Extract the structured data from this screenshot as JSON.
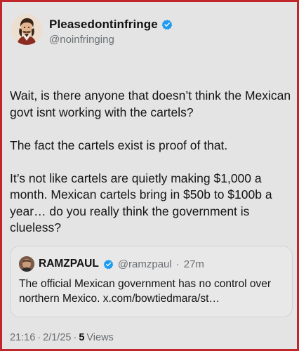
{
  "author": {
    "display_name": "Pleasedontinfringe",
    "handle": "@noinfringing",
    "verified_icon": "verified-badge-icon",
    "verified_color": "#1d9bf0"
  },
  "tweet": {
    "paragraphs": [
      "Wait, is there anyone that doesn’t think the Mexican govt isnt working with the cartels?",
      "The fact the cartels exist is proof of that.",
      "It’s not like cartels are quietly making $1,000 a month. Mexican cartels bring in $50b to $100b a year… do you really think the government is clueless?"
    ]
  },
  "quote": {
    "display_name": "RAMZPAUL",
    "handle": "@ramzpaul",
    "separator": "·",
    "time": "27m",
    "text": "The official Mexican government has no control over northern Mexico. x.com/bowtiedmara/st…"
  },
  "meta": {
    "time": "21:16",
    "separator1": "·",
    "date": "2/1/25",
    "separator2": "·",
    "views_count": "5",
    "views_label": "Views"
  }
}
